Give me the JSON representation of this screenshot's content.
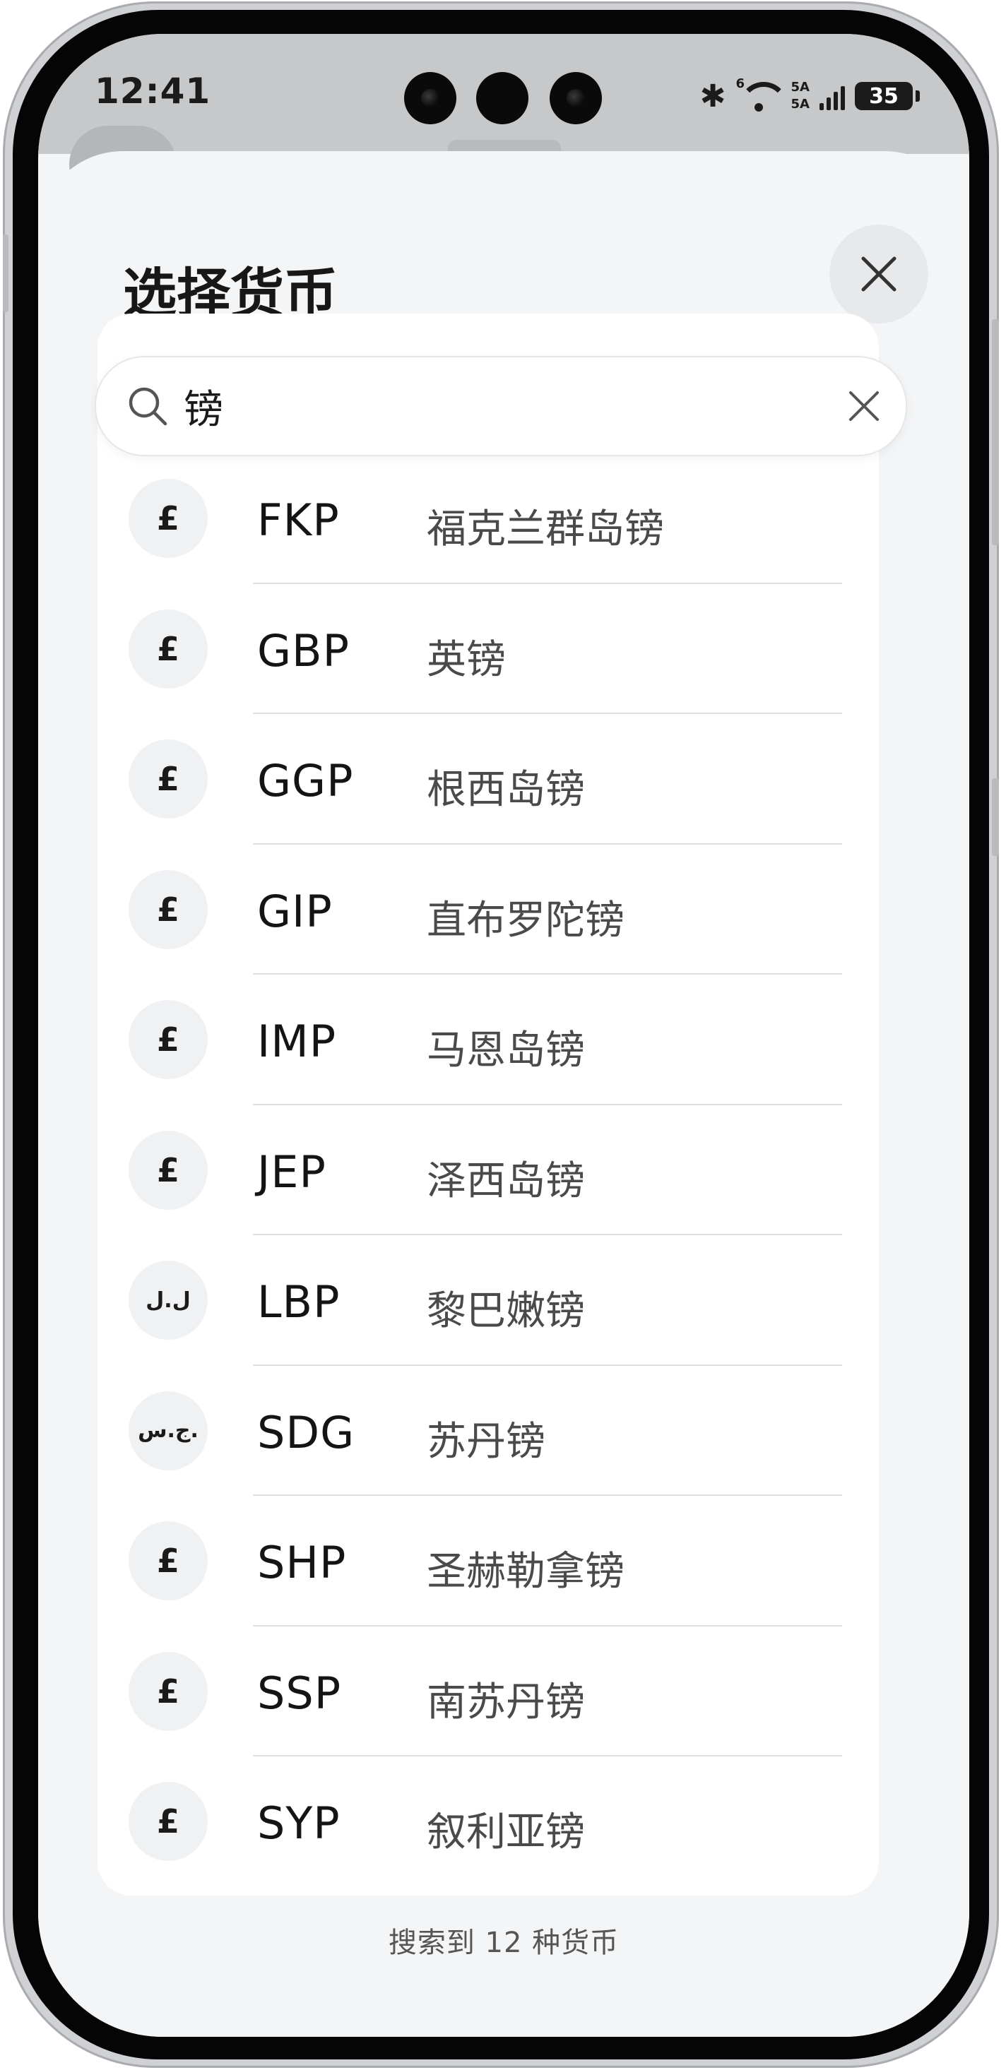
{
  "status_bar": {
    "time": "12:41",
    "wifi_tag": "6",
    "signal_line1": "5A",
    "signal_line2": "5A",
    "battery": "35"
  },
  "sheet": {
    "title": "选择货币",
    "close_icon": "close-icon"
  },
  "search": {
    "value": "镑",
    "search_icon": "search-icon",
    "clear_icon": "clear-icon"
  },
  "currencies": [
    {
      "symbol": "£",
      "code": "FKP",
      "name": "福克兰群岛镑"
    },
    {
      "symbol": "£",
      "code": "GBP",
      "name": "英镑"
    },
    {
      "symbol": "£",
      "code": "GGP",
      "name": "根西岛镑"
    },
    {
      "symbol": "£",
      "code": "GIP",
      "name": "直布罗陀镑"
    },
    {
      "symbol": "£",
      "code": "IMP",
      "name": "马恩岛镑"
    },
    {
      "symbol": "£",
      "code": "JEP",
      "name": "泽西岛镑"
    },
    {
      "symbol": "ل.ل",
      "code": "LBP",
      "name": "黎巴嫩镑"
    },
    {
      "symbol": "ج.س.",
      "code": "SDG",
      "name": "苏丹镑"
    },
    {
      "symbol": "£",
      "code": "SHP",
      "name": "圣赫勒拿镑"
    },
    {
      "symbol": "£",
      "code": "SSP",
      "name": "南苏丹镑"
    },
    {
      "symbol": "£",
      "code": "SYP",
      "name": "叙利亚镑"
    }
  ],
  "result_count_text": "搜索到 12 种货币",
  "colors": {
    "sheet_bg": "#f4f5f7",
    "card_bg": "#ffffff",
    "icon_bg": "#f0f1f3",
    "divider": "#dedfe1"
  }
}
